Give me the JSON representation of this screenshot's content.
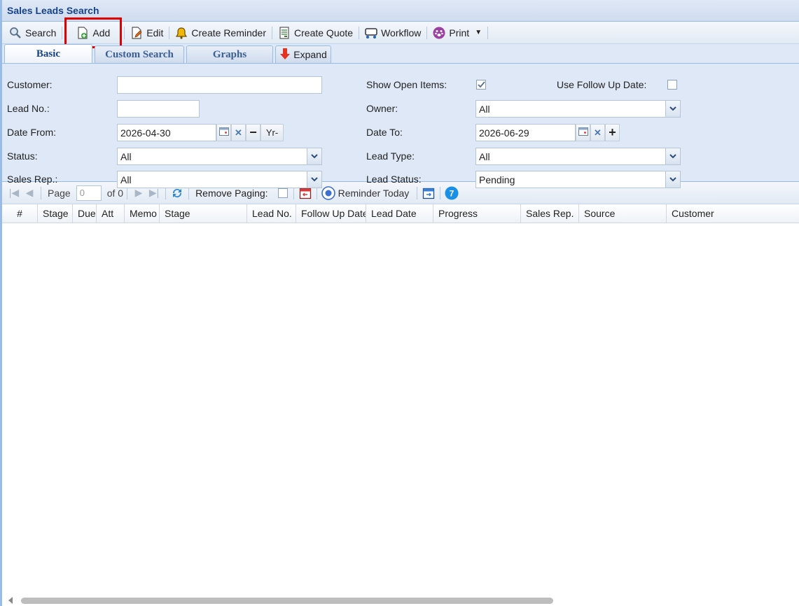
{
  "window": {
    "title": "Sales Leads Search"
  },
  "toolbar": {
    "search": "Search",
    "add": "Add",
    "edit": "Edit",
    "create_reminder": "Create Reminder",
    "create_quote": "Create Quote",
    "workflow": "Workflow",
    "print": "Print"
  },
  "tabs": [
    {
      "label": "Basic"
    },
    {
      "label": "Custom Search"
    },
    {
      "label": "Graphs"
    },
    {
      "label": "Expand"
    }
  ],
  "form": {
    "customer_label": "Customer:",
    "customer_value": "",
    "lead_no_label": "Lead No.:",
    "lead_no_value": "",
    "date_from_label": "Date From:",
    "date_from_value": "2026-04-30",
    "yr_button": "Yr-",
    "status_label": "Status:",
    "status_value": "All",
    "sales_rep_label": "Sales Rep.:",
    "sales_rep_value": "All",
    "show_open_label": "Show Open Items:",
    "show_open_checked": true,
    "use_follow_label": "Use Follow Up Date:",
    "use_follow_checked": false,
    "owner_label": "Owner:",
    "owner_value": "All",
    "date_to_label": "Date To:",
    "date_to_value": "2026-06-29",
    "lead_type_label": "Lead Type:",
    "lead_type_value": "All",
    "lead_status_label": "Lead Status:",
    "lead_status_value": "Pending"
  },
  "pager": {
    "page_label": "Page",
    "page_value": "0",
    "of_label": "of 0",
    "remove_paging": "Remove Paging:",
    "reminder_today": "Reminder Today",
    "badge": "7"
  },
  "grid": {
    "columns": [
      "#",
      "Stage",
      "Due",
      "Att",
      "Memo",
      "Stage",
      "Lead No.",
      "Follow Up Date",
      "Lead Date",
      "Progress",
      "Sales Rep.",
      "Source",
      "Customer"
    ]
  },
  "colors": {
    "accent": "#15428b",
    "highlight": "#e00000",
    "panel_bg": "#dfe8f6"
  }
}
